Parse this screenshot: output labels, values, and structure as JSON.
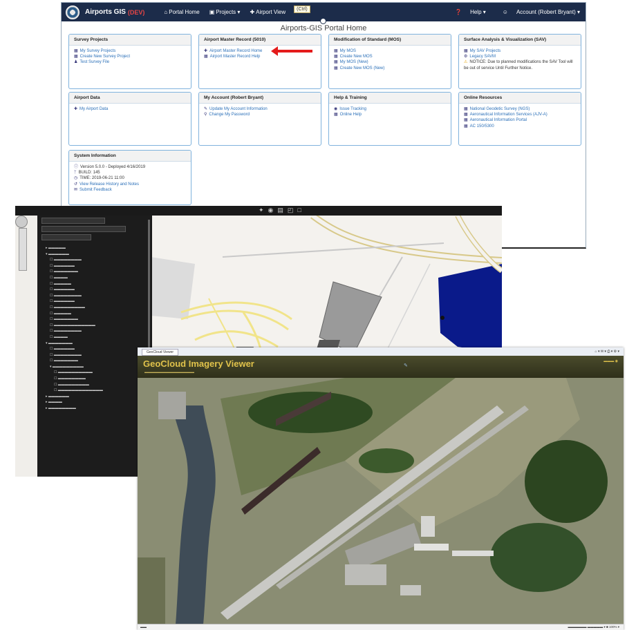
{
  "portal": {
    "brand_name": "Airports GIS",
    "brand_env": "(DEV)",
    "nav": {
      "portal_home": "Portal Home",
      "projects": "Projects",
      "airport_view": "Airport View",
      "cursor_tip": "(Ctrl)",
      "help": "Help",
      "account": "Account (Robert Bryant)"
    },
    "page_title": "Airports-GIS Portal Home",
    "cards": {
      "survey": {
        "title": "Survey Projects",
        "items": [
          "My Survey Projects",
          "Create New Survey Project",
          "Test Survey File"
        ]
      },
      "amr": {
        "title": "Airport Master Record (5010)",
        "items": [
          "Airport Master Record Home",
          "Airport Master Record Help"
        ]
      },
      "mos": {
        "title": "Modification of Standard (MOS)",
        "items": [
          "My MOS",
          "Create New MOS",
          "My MOS (New)",
          "Create New MOS (New)"
        ]
      },
      "sav": {
        "title": "Surface Analysis & Visualization (SAV)",
        "items": [
          "My SAV Projects",
          "Legacy SAVM"
        ],
        "notice": "NOTICE: Due to planned modifications the SAV Tool will be out of service Until Further Notice."
      },
      "airport_data": {
        "title": "Airport Data",
        "items": [
          "My Airport Data"
        ]
      },
      "account": {
        "title": "My Account (Robert Bryant)",
        "items": [
          "Update My Account Information",
          "Change My Password"
        ]
      },
      "help": {
        "title": "Help & Training",
        "items": [
          "Issue Tracking",
          "Online Help"
        ]
      },
      "online": {
        "title": "Online Resources",
        "items": [
          "National Geodetic Survey (NGS)",
          "Aeronautical Information Services (AJV-A)",
          "Aeronautical Information Portal",
          "AC 150/5300"
        ]
      },
      "sysinfo": {
        "title": "System Information",
        "items": [
          "Version 5.0.0 - Deployed 4/16/2019",
          "BUILD: 145",
          "TIME: 2019-06-21 11:00",
          "View Release History and Notes",
          "Submit Feedback"
        ]
      }
    }
  },
  "geocloud": {
    "title": "GeoCloud Imagery Viewer",
    "tab": "GeoCloud Viewer"
  },
  "colors": {
    "nav_bg": "#1c2c4a",
    "link": "#2a6fb8",
    "card_border": "#7fb2dd",
    "arrow": "#e41b1b",
    "water": "#0a1a8a"
  }
}
